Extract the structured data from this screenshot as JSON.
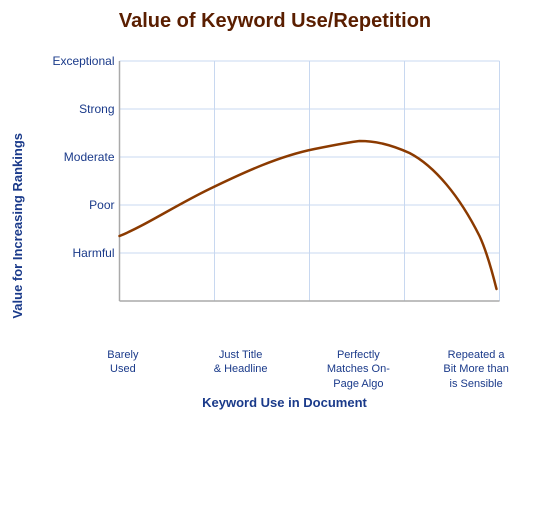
{
  "title": "Value of Keyword Use/Repetition",
  "yAxisLabel": "Value for Increasing Rankings",
  "xAxisLabel": "Keyword Use in Document",
  "yAxisTicks": [
    "Exceptional",
    "Strong",
    "Moderate",
    "Poor",
    "Harmful"
  ],
  "xAxisLabels": [
    {
      "line1": "Barely",
      "line2": "Used",
      "line3": ""
    },
    {
      "line1": "Just Title",
      "line2": "& Headline",
      "line3": ""
    },
    {
      "line1": "Perfectly",
      "line2": "Matches On-",
      "line3": "Page Algo"
    },
    {
      "line1": "Repeated a",
      "line2": "Bit More than",
      "line3": "is Sensible"
    }
  ],
  "colors": {
    "title": "#5a1e00",
    "axisLabel": "#1a3a8a",
    "gridLine": "#c8d8f0",
    "curve": "#8b3a00",
    "axisLine": "#999"
  }
}
